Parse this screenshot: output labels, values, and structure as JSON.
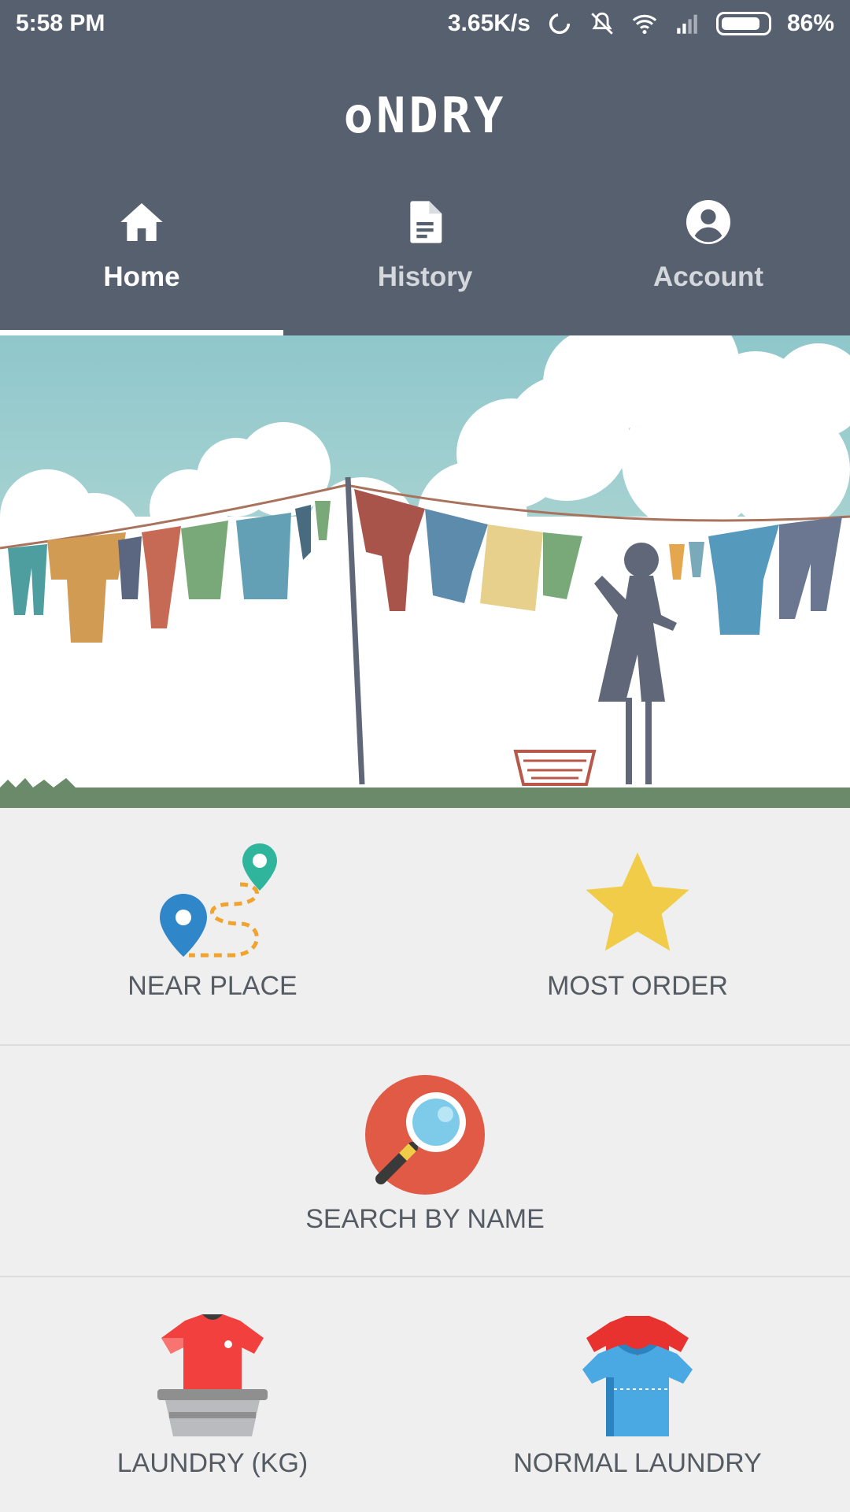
{
  "status_bar": {
    "time": "5:58 PM",
    "network_speed": "3.65K/s",
    "battery_percent": "86%",
    "battery_level": 0.86,
    "icons": [
      "sync-icon",
      "vibrate-off-icon",
      "wifi-icon",
      "signal-icon",
      "battery-icon"
    ]
  },
  "app": {
    "logo_text": "oNDRY",
    "colors": {
      "bar": "#56606f",
      "background": "#efefef",
      "star": "#f0cc48",
      "search": "#e05a46"
    }
  },
  "tabs": [
    {
      "label": "Home",
      "icon": "home-icon",
      "active": true
    },
    {
      "label": "History",
      "icon": "document-icon",
      "active": false
    },
    {
      "label": "Account",
      "icon": "account-circle-icon",
      "active": false
    }
  ],
  "menu": {
    "near_place": {
      "label": "NEAR PLACE",
      "icon": "map-route-icon"
    },
    "most_order": {
      "label": "MOST ORDER",
      "icon": "star-icon"
    },
    "search_by_name": {
      "label": "SEARCH BY NAME",
      "icon": "magnifier-icon"
    },
    "laundry_kg": {
      "label": "LAUNDRY (KG)",
      "icon": "shirt-basin-icon"
    },
    "normal_laundry": {
      "label": "NORMAL LAUNDRY",
      "icon": "shirts-icon"
    }
  }
}
